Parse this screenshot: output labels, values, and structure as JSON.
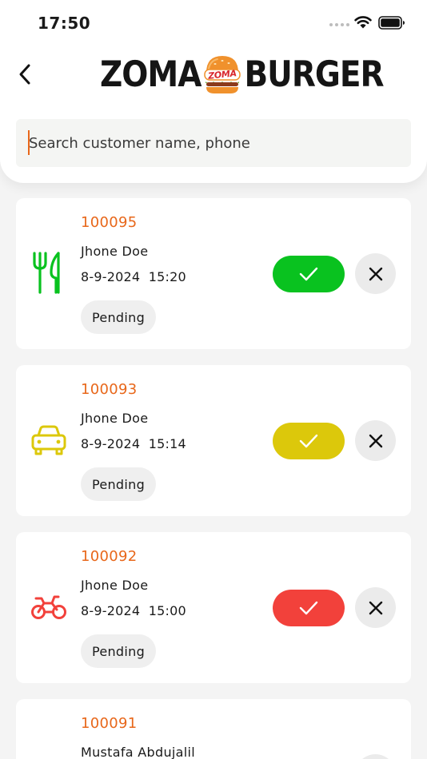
{
  "status_bar": {
    "time": "17:50"
  },
  "brand": {
    "word_left": "ZOMA",
    "badge_text": "ZOMA",
    "word_right": "BURGER"
  },
  "search": {
    "placeholder": "Search customer name, phone",
    "value": ""
  },
  "orders": [
    {
      "id": "100095",
      "customer": "Jhone Doe",
      "datetime": "8-9-2024  15:20",
      "status": "Pending",
      "type_icon": "dine-in-icon",
      "accent": "#09c21f"
    },
    {
      "id": "100093",
      "customer": "Jhone Doe",
      "datetime": "8-9-2024  15:14",
      "status": "Pending",
      "type_icon": "car-icon",
      "accent": "#dcc80b"
    },
    {
      "id": "100092",
      "customer": "Jhone Doe",
      "datetime": "8-9-2024  15:00",
      "status": "Pending",
      "type_icon": "motorbike-icon",
      "accent": "#f2413b"
    },
    {
      "id": "100091",
      "customer": "Mustafa Abdujalil"
    }
  ],
  "colors": {
    "brand_orange": "#e8671a",
    "background": "#f4f4f4",
    "card": "#ffffff"
  }
}
